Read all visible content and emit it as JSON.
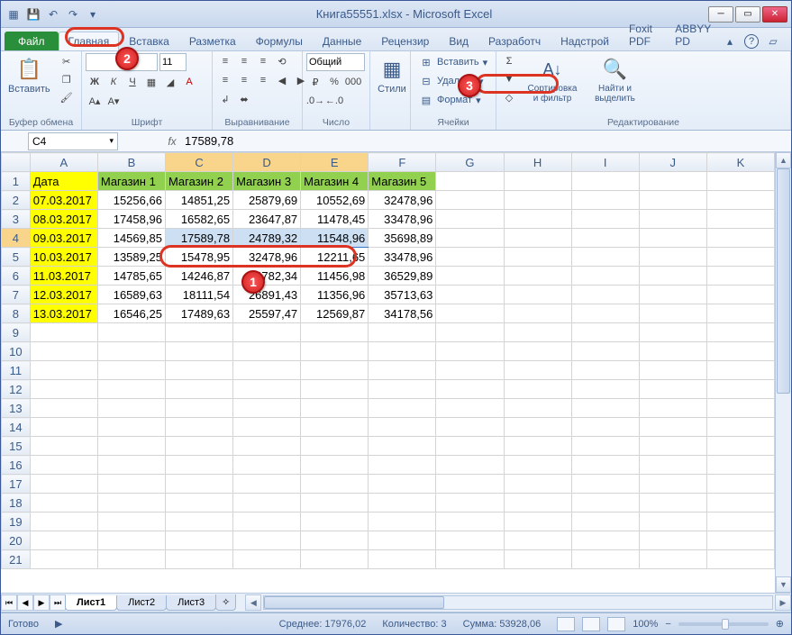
{
  "title": "Книга55551.xlsx - Microsoft Excel",
  "tabs": {
    "file": "Файл",
    "home": "Главная",
    "insert": "Вставка",
    "layout": "Разметка",
    "formulas": "Формулы",
    "data": "Данные",
    "review": "Рецензир",
    "view": "Вид",
    "developer": "Разработч",
    "addins": "Надстрой",
    "foxit": "Foxit PDF",
    "abbyy": "ABBYY PD"
  },
  "ribbon": {
    "paste": "Вставить",
    "clipboard": "Буфер обмена",
    "font_size": "11",
    "font_group": "Шрифт",
    "align_group": "Выравнивание",
    "number_format": "Общий",
    "number_group": "Число",
    "styles": "Стили",
    "insert_btn": "Вставить",
    "delete_btn": "Удалить",
    "format_btn": "Формат",
    "cells_group": "Ячейки",
    "sort": "Сортировка и фильтр",
    "find": "Найти и выделить",
    "editing_group": "Редактирование"
  },
  "name_box": "C4",
  "formula": "17589,78",
  "columns": [
    "A",
    "B",
    "C",
    "D",
    "E",
    "F",
    "G",
    "H",
    "I",
    "J",
    "K"
  ],
  "headers": [
    "Дата",
    "Магазин 1",
    "Магазин 2",
    "Магазин 3",
    "Магазин 4",
    "Магазин 5"
  ],
  "rows": [
    {
      "d": "07.03.2017",
      "v": [
        "15256,66",
        "14851,25",
        "25879,69",
        "10552,69",
        "32478,96"
      ]
    },
    {
      "d": "08.03.2017",
      "v": [
        "17458,96",
        "16582,65",
        "23647,87",
        "11478,45",
        "33478,96"
      ]
    },
    {
      "d": "09.03.2017",
      "v": [
        "14569,85",
        "17589,78",
        "24789,32",
        "11548,96",
        "35698,89"
      ]
    },
    {
      "d": "10.03.2017",
      "v": [
        "13589,25",
        "15478,95",
        "32478,96",
        "12211,65",
        "33478,96"
      ]
    },
    {
      "d": "11.03.2017",
      "v": [
        "14785,65",
        "14246,87",
        "14782,34",
        "11456,98",
        "36529,89"
      ]
    },
    {
      "d": "12.03.2017",
      "v": [
        "16589,63",
        "18111,54",
        "26891,43",
        "11356,96",
        "35713,63"
      ]
    },
    {
      "d": "13.03.2017",
      "v": [
        "16546,25",
        "17489,63",
        "25597,47",
        "12569,87",
        "34178,56"
      ]
    }
  ],
  "sheets": {
    "s1": "Лист1",
    "s2": "Лист2",
    "s3": "Лист3"
  },
  "status": {
    "ready": "Готово",
    "avg": "Среднее: 17976,02",
    "count": "Количество: 3",
    "sum": "Сумма: 53928,06",
    "zoom": "100%"
  },
  "badges": {
    "b1": "1",
    "b2": "2",
    "b3": "3"
  },
  "marks": {
    "minus": "−",
    "plus": "+",
    "zplus": "⊕"
  }
}
